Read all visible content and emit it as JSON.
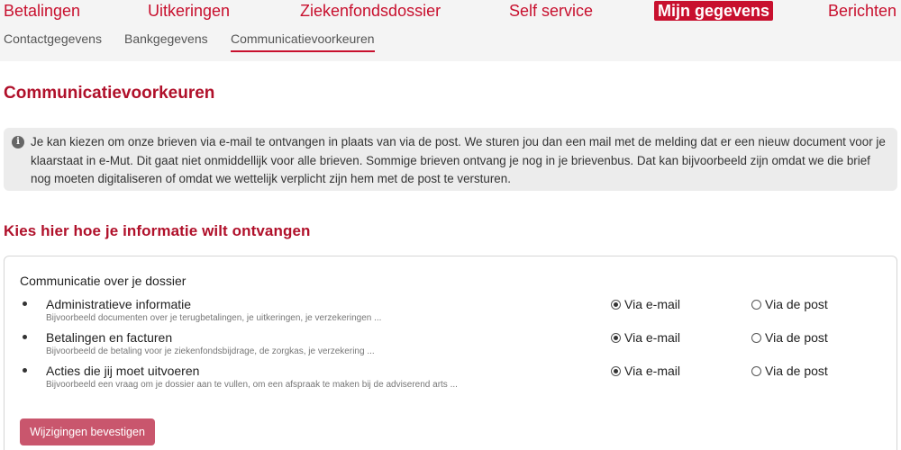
{
  "nav": {
    "main": [
      {
        "label": "Betalingen"
      },
      {
        "label": "Uitkeringen"
      },
      {
        "label": "Ziekenfondsdossier"
      },
      {
        "label": "Self service"
      },
      {
        "label": "Mijn gegevens",
        "active": true
      },
      {
        "label": "Berichten"
      }
    ],
    "sub": [
      {
        "label": "Contactgegevens"
      },
      {
        "label": "Bankgegevens"
      },
      {
        "label": "Communicatievoorkeuren",
        "active": true
      }
    ]
  },
  "page": {
    "title": "Communicatievoorkeuren",
    "info_text": "Je kan kiezen om onze brieven via e-mail te ontvangen in plaats van via de post. We sturen jou dan een mail met de melding dat er een nieuw document voor je klaarstaat in e-Mut. Dit gaat niet onmiddellijk voor alle brieven. Sommige brieven ontvang je nog in je brievenbus. Dat kan bijvoorbeeld zijn omdat we die brief nog moeten digitaliseren of omdat we wettelijk verplicht zijn hem met de post te versturen.",
    "section_title": "Kies hier hoe je informatie wilt ontvangen"
  },
  "card": {
    "title": "Communicatie over je dossier",
    "option_email": "Via e-mail",
    "option_post": "Via de post",
    "items": [
      {
        "label": "Administratieve informatie",
        "description": "Bijvoorbeeld documenten over je terugbetalingen, je uitkeringen, je verzekeringen ...",
        "selected": "email"
      },
      {
        "label": "Betalingen en facturen",
        "description": "Bijvoorbeeld de betaling voor je ziekenfondsbijdrage, de zorgkas, je verzekering ...",
        "selected": "email"
      },
      {
        "label": "Acties die jij moet uitvoeren",
        "description": "Bijvoorbeeld een vraag om je dossier aan te vullen, om een afspraak te maken bij de adviserend arts ...",
        "selected": "email"
      }
    ],
    "confirm_label": "Wijzigingen bevestigen"
  },
  "colors": {
    "brand_red": "#c8102e",
    "title_red": "#b0102a",
    "button": "#c9566d",
    "info_bg": "#ececec"
  }
}
